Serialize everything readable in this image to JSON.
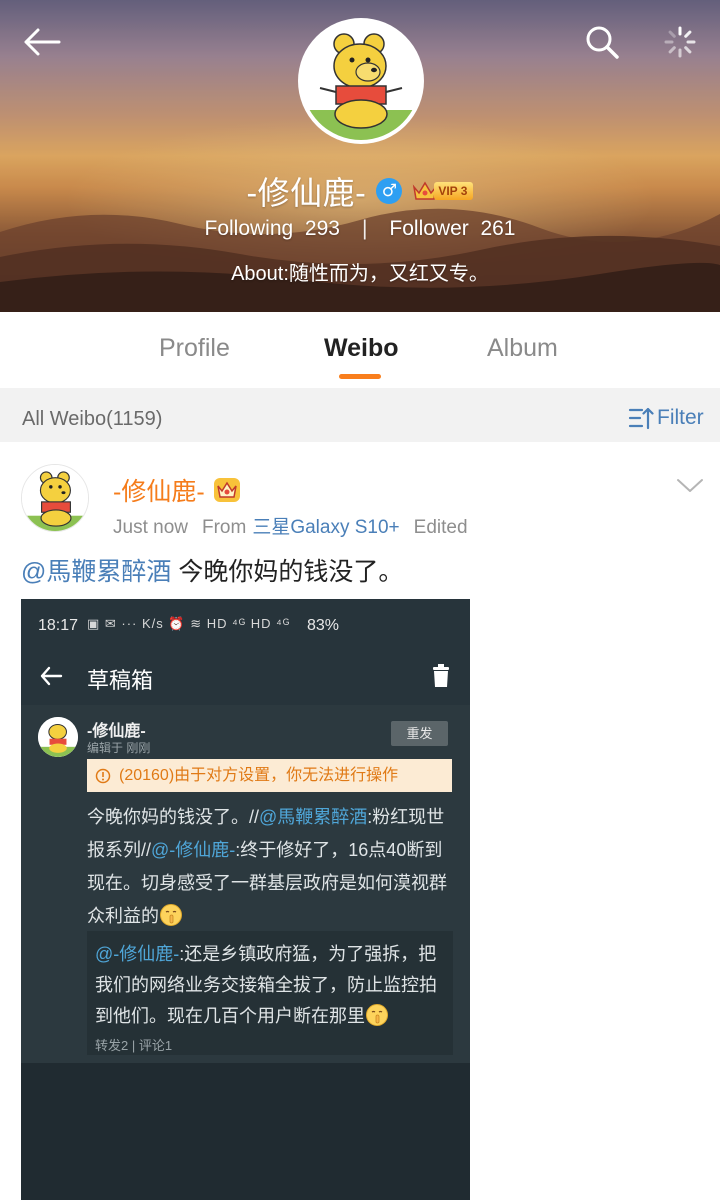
{
  "header": {
    "profile_name": "-修仙鹿-",
    "gender_symbol": "♂",
    "vip_label": "VIP 3",
    "following_label": "Following",
    "following_count": "293",
    "stats_separator": "|",
    "follower_label": "Follower",
    "follower_count": "261",
    "about": "About:随性而为，又红又专。"
  },
  "tabs": [
    {
      "label": "Profile",
      "active": false
    },
    {
      "label": "Weibo",
      "active": true
    },
    {
      "label": "Album",
      "active": false
    }
  ],
  "filter_bar": {
    "count_label": "All Weibo(1159)",
    "filter_label": "Filter"
  },
  "post": {
    "author": "-修仙鹿-",
    "time": "Just now",
    "from_label": "From",
    "source": "三星Galaxy S10+",
    "edited_label": "Edited",
    "mention": "@馬鞭累醉酒",
    "text": " 今晚你妈的钱没了。"
  },
  "screenshot": {
    "status_time": "18:17",
    "status_icons": "▣ ✉ ··· K/s ⏰ ≋ HD ⁴ᴳ HD ⁴ᴳ",
    "battery": "83%",
    "appbar_title": "草稿箱",
    "card_name": "-修仙鹿-",
    "card_sub": "编辑于 刚刚",
    "repost_label": "重发",
    "warning": "(20160)由于对方设置，你无法进行操作",
    "text_part1": "今晚你妈的钱没了。//",
    "mention1": "@馬鞭累醉酒",
    "text_part2": ":粉红现世报系列//",
    "mention2": "@-修仙鹿-",
    "text_part3": ":终于修好了，16点40断到现在。切身感受了一群基层政府是如何漠视群众利益的",
    "quote_mention": "@-修仙鹿-",
    "quote_text": ":还是乡镇政府猛，为了强拆，把我们的网络业务交接箱全拔了，防止监控拍到他们。现在几百个用户断在那里",
    "quote_stats": "转发2 | 评论1"
  },
  "colors": {
    "accent_orange": "#f97e1c",
    "link_blue": "#4a7fb8",
    "author_orange": "#f57c1b"
  }
}
